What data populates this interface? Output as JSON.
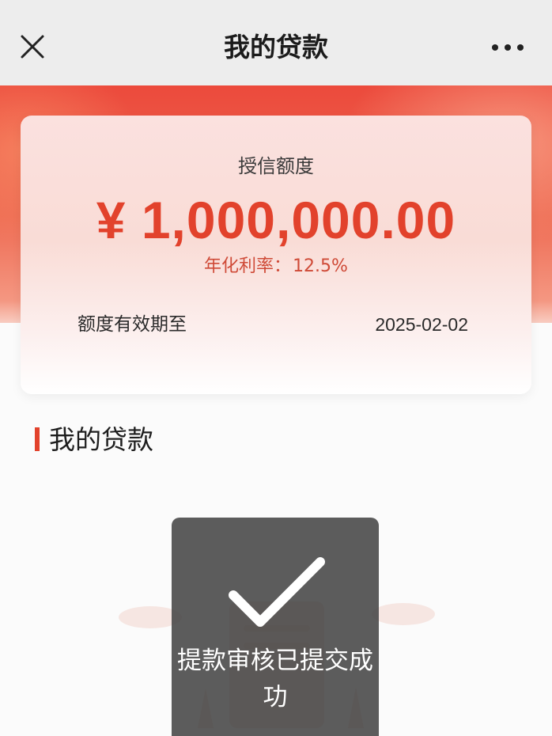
{
  "nav": {
    "title": "我的贷款",
    "close_icon": "close-icon",
    "more_icon": "more-horizontal-icon"
  },
  "card": {
    "label": "授信额度",
    "amount": "¥ 1,000,000.00",
    "rate_label": "年化利率：",
    "rate_value": "12.5%",
    "expiry_label": "额度有效期至",
    "expiry_date": "2025-02-02"
  },
  "section": {
    "title": "我的贷款"
  },
  "toast": {
    "icon": "checkmark-icon",
    "message": "提款审核已提交成功"
  },
  "colors": {
    "accent_red": "#e2422c",
    "nav_bg": "#ededed",
    "toast_bg": "#464646"
  }
}
